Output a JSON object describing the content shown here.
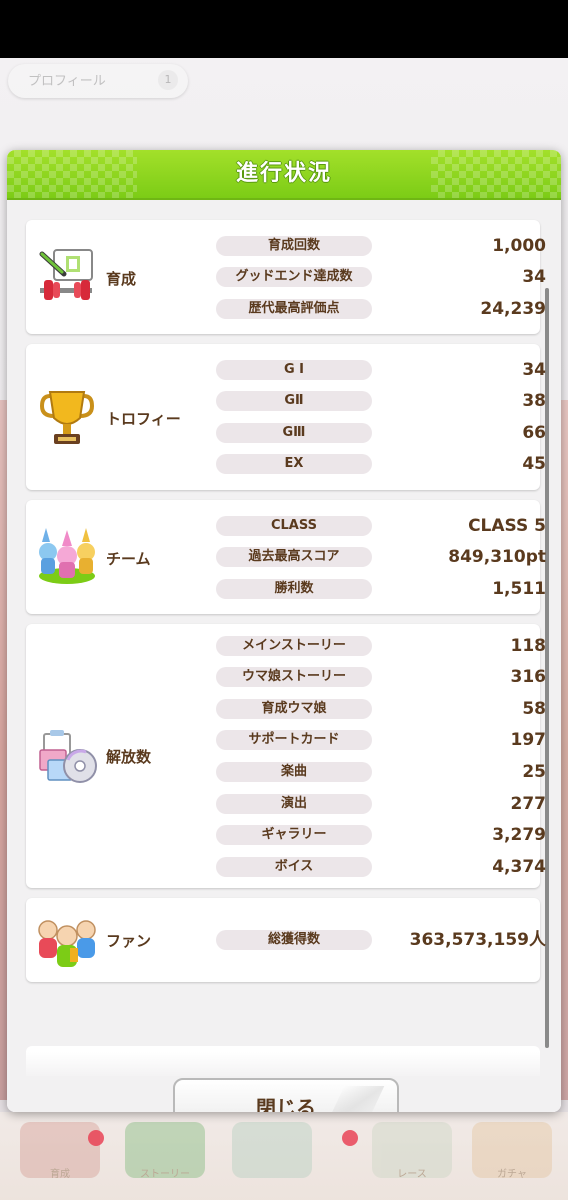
{
  "background": {
    "profile_tab_label": "プロフィール",
    "profile_tab_number": "1",
    "nav_items": [
      "育成",
      "ストーリー",
      "",
      "レース",
      "ガチャ"
    ]
  },
  "dialog": {
    "title": "進行状況",
    "close_label": "閉じる"
  },
  "sections": {
    "training": {
      "label": "育成",
      "icon": "training-icon",
      "rows": [
        {
          "label": "育成回数",
          "value": "1,000"
        },
        {
          "label": "グッドエンド達成数",
          "value": "34"
        },
        {
          "label": "歴代最高評価点",
          "value": "24,239"
        }
      ]
    },
    "trophy": {
      "label": "トロフィー",
      "icon": "trophy-icon",
      "rows": [
        {
          "label": "G I",
          "value": "34"
        },
        {
          "label": "GⅡ",
          "value": "38"
        },
        {
          "label": "GⅢ",
          "value": "66"
        },
        {
          "label": "EX",
          "value": "45"
        }
      ]
    },
    "team": {
      "label": "チーム",
      "icon": "team-icon",
      "rows": [
        {
          "label": "CLASS",
          "value": "CLASS 5"
        },
        {
          "label": "過去最高スコア",
          "value": "849,310pt"
        },
        {
          "label": "勝利数",
          "value": "1,511"
        }
      ]
    },
    "unlock": {
      "label": "解放数",
      "icon": "unlock-icon",
      "rows": [
        {
          "label": "メインストーリー",
          "value": "118"
        },
        {
          "label": "ウマ娘ストーリー",
          "value": "316"
        },
        {
          "label": "育成ウマ娘",
          "value": "58"
        },
        {
          "label": "サポートカード",
          "value": "197"
        },
        {
          "label": "楽曲",
          "value": "25"
        },
        {
          "label": "演出",
          "value": "277"
        },
        {
          "label": "ギャラリー",
          "value": "3,279"
        },
        {
          "label": "ボイス",
          "value": "4,374"
        }
      ]
    },
    "fans": {
      "label": "ファン",
      "icon": "fans-icon",
      "rows": [
        {
          "label": "総獲得数",
          "value": "363,573,159人"
        }
      ]
    }
  },
  "colors": {
    "header_green": "#7ccc16",
    "text_brown": "#5a3a1e",
    "pill_bg": "#ece6e9"
  }
}
